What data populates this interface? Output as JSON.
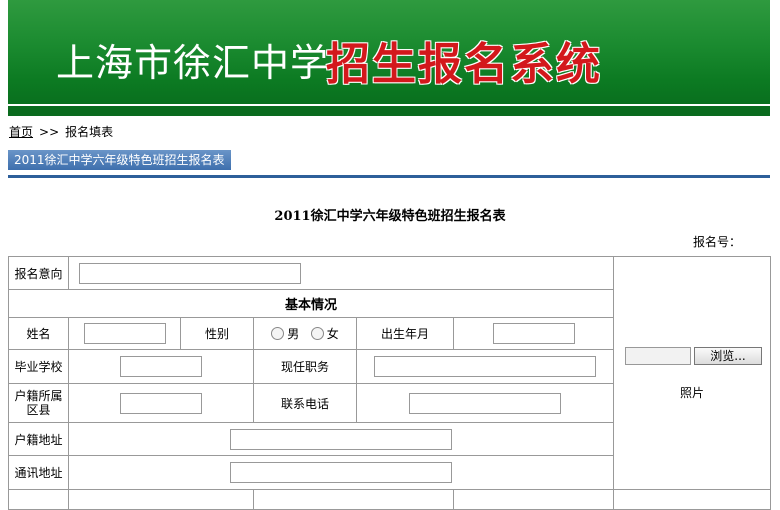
{
  "banner": {
    "title": "上海市徐汇中学",
    "subtitle": "招生报名系统"
  },
  "breadcrumb": {
    "home": "首页",
    "separator": ">>",
    "current": "报名填表"
  },
  "tab": {
    "label": "2011徐汇中学六年级特色班招生报名表"
  },
  "form": {
    "title": "2011徐汇中学六年级特色班招生报名表",
    "reg_no_label": "报名号：",
    "intent_label": "报名意向",
    "section_basic": "基本情况",
    "name_label": "姓名",
    "gender_label": "性别",
    "gender_male": "男",
    "gender_female": "女",
    "birth_label": "出生年月",
    "school_label": "毕业学校",
    "position_label": "现任职务",
    "hukou_label": "户籍所属区县",
    "phone_label": "联系电话",
    "hukou_addr_label": "户籍地址",
    "mail_addr_label": "通讯地址",
    "browse_label": "浏览...",
    "photo_label": "照片"
  },
  "colors": {
    "banner_green": "#1a8a2f",
    "subtitle_red": "#d3181c",
    "tab_blue": "#3e6fad"
  }
}
